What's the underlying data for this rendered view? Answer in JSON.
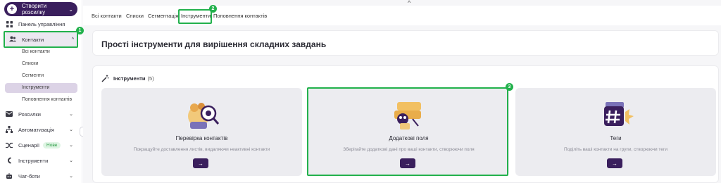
{
  "sidebar": {
    "create_label": "Створити розсилку",
    "items": [
      {
        "label": "Панель управління",
        "icon": "grid-icon"
      },
      {
        "label": "Контакти",
        "icon": "users-icon"
      },
      {
        "label": "Розсилки",
        "icon": "mail-icon"
      },
      {
        "label": "Автоматизація",
        "icon": "flow-icon"
      },
      {
        "label": "Сценарії",
        "icon": "shuffle-icon",
        "badge": "Нове"
      },
      {
        "label": "Інструменти",
        "icon": "tools-icon"
      },
      {
        "label": "Чат-боти",
        "icon": "bot-icon"
      }
    ],
    "contacts_sub": [
      "Всі контакти",
      "Списки",
      "Сегменти",
      "Інструменти",
      "Поповнення контактів"
    ]
  },
  "tabs": [
    "Всі контакти",
    "Списки",
    "Сегментація",
    "Інструменти",
    "Поповнення контактів"
  ],
  "header": {
    "title": "Прості інструменти для вирішення складних завдань"
  },
  "tools": {
    "heading": "Інструменти",
    "count": "(5)",
    "cards": [
      {
        "title": "Перевірка контактів",
        "desc": "Покращуйте доставлення листів, видаляючи неактивні контакти",
        "btn": "→"
      },
      {
        "title": "Додаткові поля",
        "desc": "Зберігайте додаткові дані про ваші контакти, створюючи поля",
        "btn": "→"
      },
      {
        "title": "Теги",
        "desc": "Поділіть ваші контакти на групи, створюючи теги",
        "btn": "→"
      }
    ]
  },
  "annotations": [
    "1",
    "2",
    "3"
  ],
  "colors": {
    "accent": "#3a1f5d",
    "highlight": "#22b14c"
  }
}
